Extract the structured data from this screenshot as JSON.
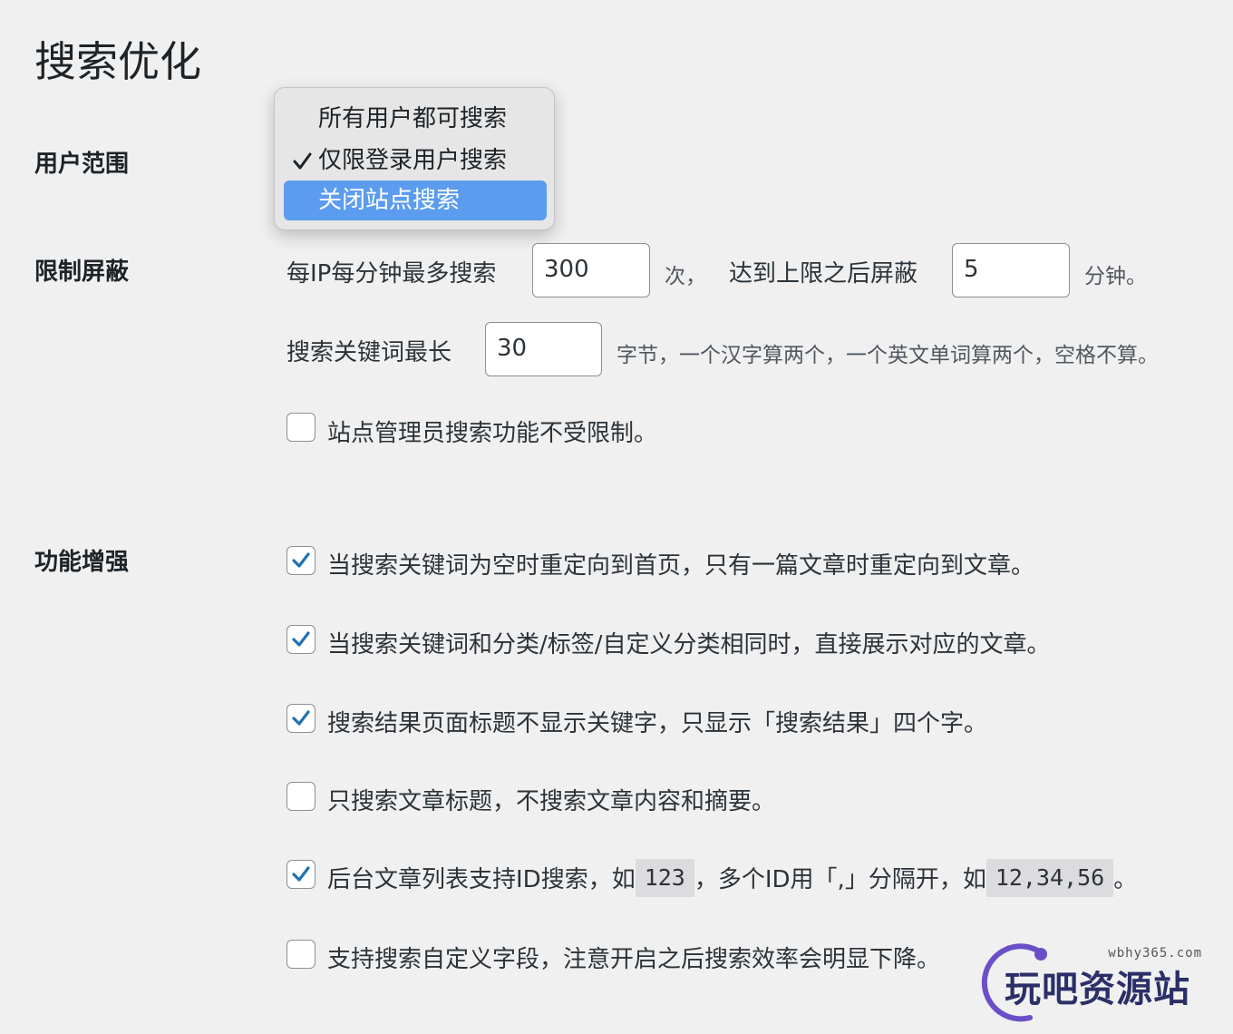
{
  "page_title": "搜索优化",
  "user_scope": {
    "label": "用户范围",
    "options": [
      "所有用户都可搜索",
      "仅限登录用户搜索",
      "关闭站点搜索"
    ],
    "checked_option": "仅限登录用户搜索",
    "highlighted_option": "关闭站点搜索"
  },
  "limit": {
    "label": "限制屏蔽",
    "per_ip_prefix": "每IP每分钟最多搜索",
    "per_ip_value": "300",
    "per_ip_unit": "次，",
    "block_prefix": "达到上限之后屏蔽",
    "block_value": "5",
    "block_unit": "分钟。",
    "keyword_prefix": "搜索关键词最长",
    "keyword_value": "30",
    "keyword_desc": "字节，一个汉字算两个，一个英文单词算两个，空格不算。",
    "admin_exempt_label": "站点管理员搜索功能不受限制。",
    "admin_exempt_checked": false
  },
  "enhance": {
    "label": "功能增强",
    "options": [
      {
        "label": "当搜索关键词为空时重定向到首页，只有一篇文章时重定向到文章。",
        "checked": true
      },
      {
        "label": "当搜索关键词和分类/标签/自定义分类相同时，直接展示对应的文章。",
        "checked": true
      },
      {
        "label": "搜索结果页面标题不显示关键字，只显示「搜索结果」四个字。",
        "checked": true
      },
      {
        "label": "只搜索文章标题，不搜索文章内容和摘要。",
        "checked": false
      },
      {
        "label_parts": [
          "后台文章列表支持ID搜索，如",
          "123",
          "，多个ID用「,」分隔开，如",
          "12,34,56",
          "。"
        ],
        "checked": true
      },
      {
        "label": "支持搜索自定义字段，注意开启之后搜索效率会明显下降。",
        "checked": false
      }
    ]
  },
  "watermark": {
    "domain": "wbhy365.com",
    "text": "玩吧资源站"
  },
  "colors": {
    "checkbox_accent": "#2271b1",
    "dropdown_highlight": "#5b9cee"
  }
}
